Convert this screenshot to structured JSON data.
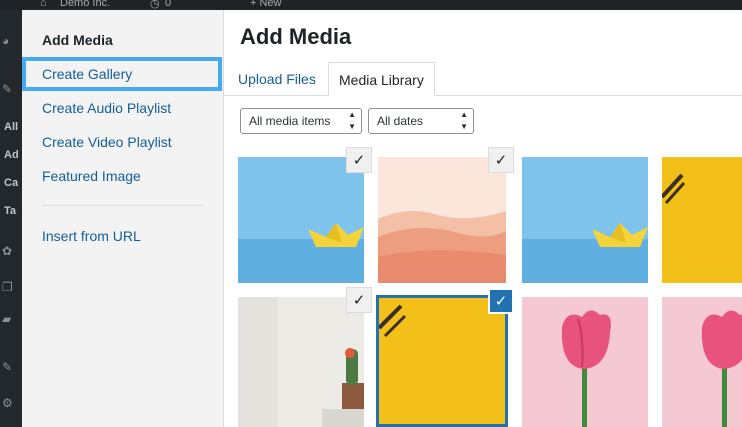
{
  "admin_bar": {
    "site_name": "Demo Inc.",
    "comments": "0",
    "new": "+ New"
  },
  "admin_menu": {
    "items": [
      "All",
      "Ad",
      "Ca",
      "Ta"
    ]
  },
  "sidebar": {
    "title": "Add Media",
    "links": [
      "Create Gallery",
      "Create Audio Playlist",
      "Create Video Playlist",
      "Featured Image",
      "Insert from URL"
    ]
  },
  "main": {
    "heading": "Add Media",
    "tabs": [
      {
        "label": "Upload Files",
        "active": false
      },
      {
        "label": "Media Library",
        "active": true
      }
    ],
    "filters": {
      "type": "All media items",
      "date": "All dates"
    }
  },
  "media_items": [
    {
      "subject": "paper boat on blue",
      "selected": true
    },
    {
      "subject": "pink desert dunes",
      "selected": true
    },
    {
      "subject": "paper boat on blue",
      "selected": false
    },
    {
      "subject": "brush on yellow",
      "selected": false
    },
    {
      "subject": "cactus on white desk",
      "selected": true
    },
    {
      "subject": "brush on yellow",
      "selected": true,
      "focused": true
    },
    {
      "subject": "pink tulip",
      "selected": false
    },
    {
      "subject": "pink tulip",
      "selected": false
    }
  ],
  "colors": {
    "link": "#135e96",
    "highlight": "#45aaf2",
    "selected": "#2271b1",
    "sky_blue": "#6fbde8",
    "sand": "#f0b49a",
    "yellow": "#f3c01a",
    "pink": "#f5c9d3"
  }
}
